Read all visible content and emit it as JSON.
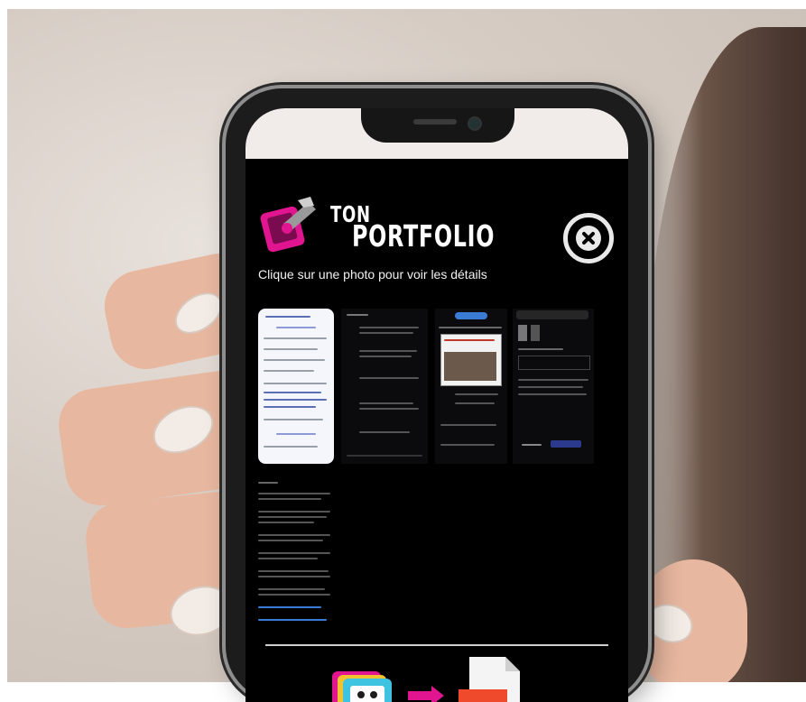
{
  "logo": {
    "line1": "TON",
    "line2": "PORTFOLIO"
  },
  "subtitle": "Clique sur une photo pour voir les détails",
  "close_icon": "close-circle-icon",
  "thumbnails": [
    "photo-thumbnail",
    "photo-thumbnail",
    "photo-thumbnail",
    "photo-thumbnail",
    "document-thumbnail"
  ],
  "bottom_icons": [
    "photos-stack-icon",
    "arrow-right-icon",
    "file-icon"
  ],
  "colors": {
    "accent_magenta": "#e0158f",
    "screen_bg": "#000000",
    "text": "#f2f2f2"
  }
}
